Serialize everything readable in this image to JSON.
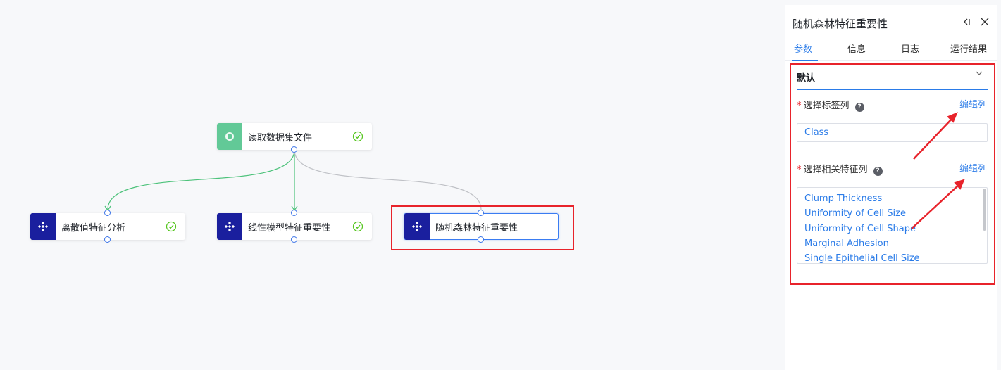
{
  "canvas": {
    "nodes": [
      {
        "id": "read-dataset",
        "label": "读取数据集文件",
        "icon": "dataset-icon",
        "status": "success"
      },
      {
        "id": "outlier-analysis",
        "label": "离散值特征分析",
        "icon": "component-icon",
        "status": "success"
      },
      {
        "id": "linear-importance",
        "label": "线性模型特征重要性",
        "icon": "component-icon",
        "status": "success"
      },
      {
        "id": "rf-importance",
        "label": "随机森林特征重要性",
        "icon": "component-icon",
        "status": "selected"
      }
    ]
  },
  "panel": {
    "title": "随机森林特征重要性",
    "tools": {
      "collapse": "collapse-icon",
      "close": "close-icon"
    },
    "tabs": [
      {
        "label": "参数",
        "active": true
      },
      {
        "label": "信息",
        "active": false
      },
      {
        "label": "日志",
        "active": false
      },
      {
        "label": "运行结果",
        "active": false
      }
    ],
    "section": {
      "label": "默认",
      "expanded": true
    },
    "label_field": {
      "label": "选择标签列",
      "required_mark": "*",
      "help": "?",
      "edit_link": "编辑列",
      "value": "Class"
    },
    "feature_field": {
      "label": "选择相关特征列",
      "required_mark": "*",
      "help": "?",
      "edit_link": "编辑列",
      "items": [
        "Clump Thickness",
        "Uniformity of Cell Size",
        "Uniformity of Cell Shape",
        "Marginal Adhesion",
        "Single Epithelial Cell Size"
      ]
    }
  },
  "colors": {
    "accent": "#2a7be8",
    "annotation_red": "#e8232b",
    "node_blue": "#1a1f9e",
    "node_green": "#62c997",
    "success_green": "#52c41a"
  }
}
